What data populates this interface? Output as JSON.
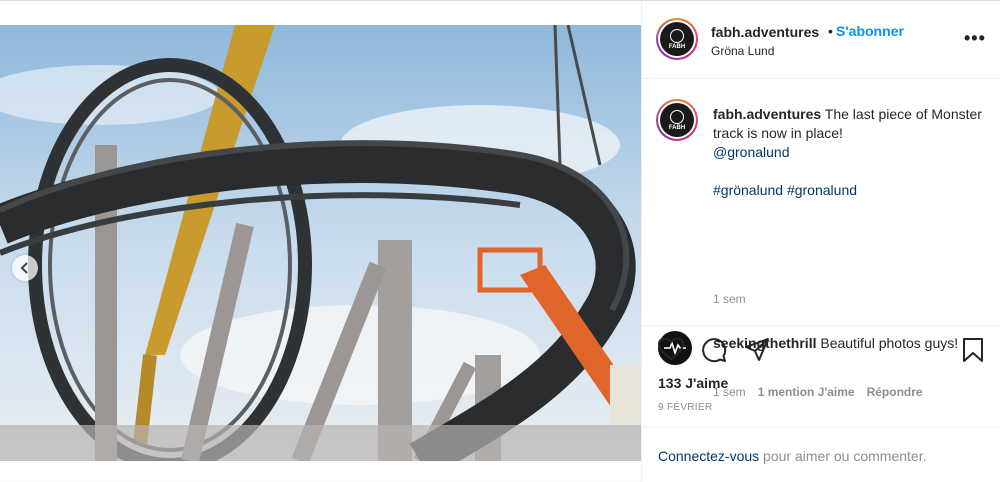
{
  "post": {
    "username": "fabh.adventures",
    "follow_label": "S'abonner",
    "dot": "•",
    "location": "Gröna Lund",
    "more": "•••",
    "avatar_text": "FABH"
  },
  "caption": {
    "username": "fabh.adventures",
    "text": "The last piece of Monster track is now in place!",
    "mention": "@gronalund",
    "hashtags": "#grönalund #gronalund",
    "time": "1 sem"
  },
  "comment": {
    "username": "seekingthethrill",
    "text": "Beautiful photos guys!",
    "time": "1 sem",
    "likes": "1 mention J'aime",
    "reply": "Répondre"
  },
  "likes": "133 J'aime",
  "date": "9 FÉVRIER",
  "footer": {
    "login_link": "Connectez-vous",
    "login_rest": " pour aimer ou commenter."
  },
  "colors": {
    "accent": "#0095f6",
    "link": "#00376b",
    "muted": "#8e8e8e"
  },
  "icons": [
    "heart-icon",
    "comment-icon",
    "share-icon",
    "bookmark-icon",
    "chevron-left-icon",
    "more-icon"
  ]
}
